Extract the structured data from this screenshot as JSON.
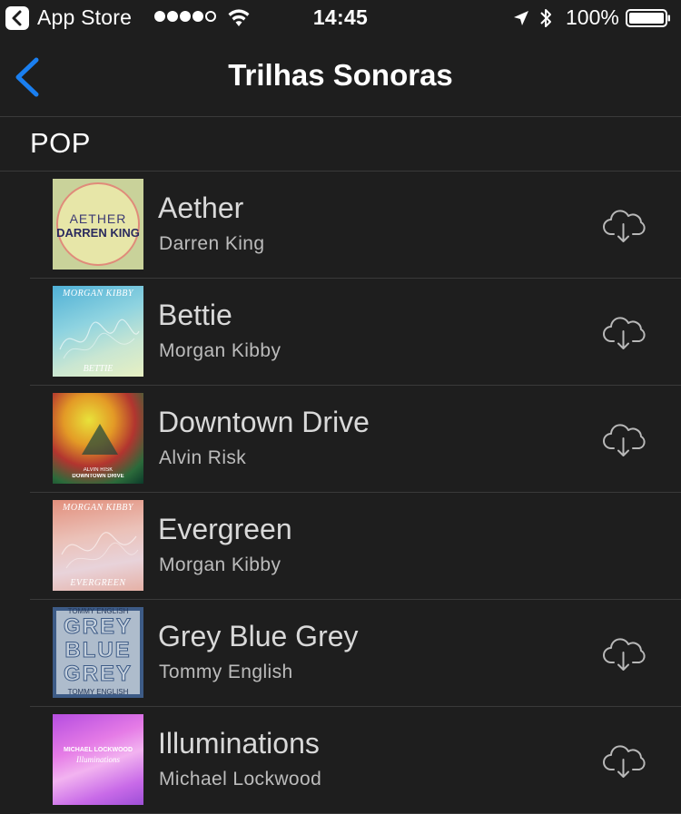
{
  "status_bar": {
    "app_name": "App Store",
    "time": "14:45",
    "battery_percent": "100%",
    "signal_bars": 4,
    "signal_total": 5
  },
  "nav": {
    "title": "Trilhas Sonoras",
    "accent_color": "#1a7ff0"
  },
  "section": {
    "title": "POP"
  },
  "tracks": [
    {
      "title": "Aether",
      "artist": "Darren King",
      "art_lines": [
        "AETHER",
        "DARREN KING"
      ]
    },
    {
      "title": "Bettie",
      "artist": "Morgan Kibby",
      "art_lines": [
        "MORGAN KIBBY",
        "BETTIE"
      ]
    },
    {
      "title": "Downtown Drive",
      "artist": "Alvin Risk",
      "art_lines": [
        "ALVIN RISK",
        "DOWNTOWN DRIVE"
      ]
    },
    {
      "title": "Evergreen",
      "artist": "Morgan Kibby",
      "art_lines": [
        "MORGAN KIBBY",
        "EVERGREEN"
      ]
    },
    {
      "title": "Grey Blue Grey",
      "artist": "Tommy English",
      "art_lines": [
        "TOMMY ENGLISH",
        "GREY",
        "BLUE",
        "GREY",
        "TOMMY ENGLISH"
      ]
    },
    {
      "title": "Illuminations",
      "artist": "Michael Lockwood",
      "art_lines": [
        "MICHAEL LOCKWOOD",
        "Illuminations"
      ]
    }
  ],
  "icons": {
    "back": "chevron-left-icon",
    "download": "cloud-download-icon"
  }
}
